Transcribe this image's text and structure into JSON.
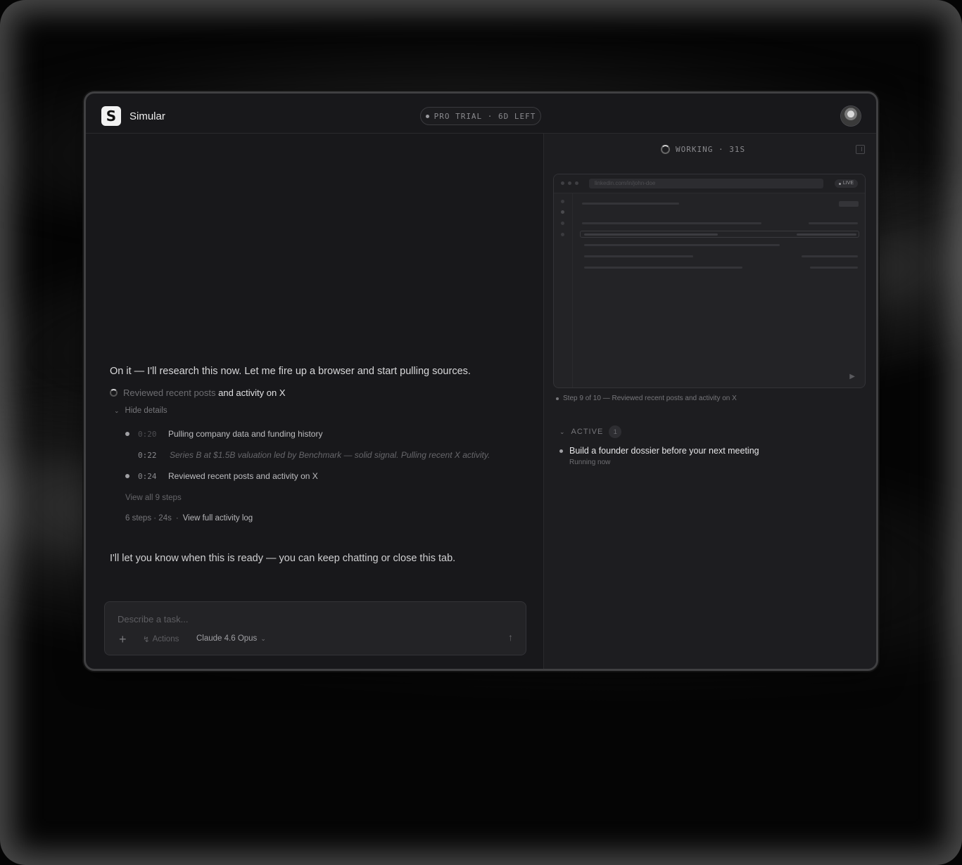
{
  "app": {
    "name": "Simular",
    "logo_letter": "S"
  },
  "trial_badge": "PRO TRIAL · 6D LEFT",
  "chat": {
    "message_intro": "On it — I'll research this now. Let me fire up a browser and start pulling sources.",
    "current_step": {
      "dim": "Reviewed recent posts",
      "bright": " and activity on X"
    },
    "hide_details": "Hide details",
    "log": [
      {
        "time": "0:20",
        "text": "Pulling company data and funding history",
        "bullet": true,
        "italic": false
      },
      {
        "time": "0:22",
        "text": "Series B at $1.5B valuation led by Benchmark — solid signal. Pulling recent X activity.",
        "bullet": false,
        "italic": true
      },
      {
        "time": "0:24",
        "text": "Reviewed recent posts and activity on X",
        "bullet": true,
        "italic": false
      }
    ],
    "view_all_steps": "View all 9 steps",
    "summary": {
      "meta": "6 steps · 24s",
      "sep": "·",
      "link": "View full activity log"
    },
    "message_outro": "I'll let you know when this is ready — you can keep chatting or close this tab."
  },
  "composer": {
    "placeholder": "Describe a task...",
    "actions_label": "Actions",
    "model_label": "Claude 4.6 Opus"
  },
  "panel": {
    "status": "WORKING · 31S",
    "browser": {
      "url": "linkedin.com/in/john-doe",
      "live_label": "LIVE"
    },
    "step_caption": "Step 9 of 10 — Reviewed recent posts and activity on X",
    "active_label": "ACTIVE",
    "active_count": "1",
    "tasks": [
      {
        "title": "Build a founder dossier before your next meeting",
        "status": "Running now"
      }
    ]
  }
}
